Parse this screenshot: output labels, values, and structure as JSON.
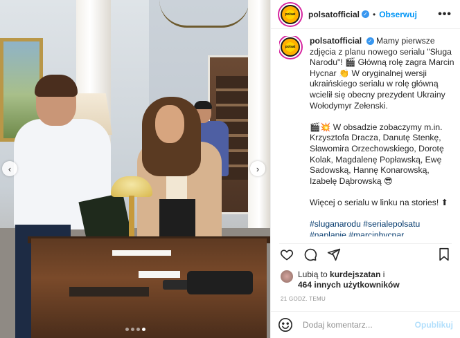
{
  "post": {
    "username": "polsatofficial",
    "verified_mark": "✓",
    "separator": "•",
    "follow_label": "Obserwuj",
    "more_label": "•••",
    "avatar_text": "polsat"
  },
  "caption": {
    "username": "polsatofficial",
    "paragraph1": "Mamy pierwsze zdjęcia z planu nowego serialu \"Sługa Narodu\"! 🎬 Główną rolę zagra Marcin Hycnar 👏 W oryginalnej wersji ukraińskiego serialu w rolę główną wcielił się obecny prezydent Ukrainy Wołodymyr Zełenski.",
    "paragraph2": "🎬💥 W obsadzie zobaczymy m.in. Krzysztofa Dracza, Danutę Stenkę, Sławomira Orzechowskiego, Dorotę Kolak, Magdalenę Popławską, Ewę Sadowską, Hannę Konarowską, Izabelę Dąbrowską 😎",
    "paragraph3": "Więcej o serialu w linku na stories! ⬆",
    "hashtags": "#sluganarodu #serialepolsatu #naplanie #marcinhycnar"
  },
  "icons": {
    "like": "heart-icon",
    "comment": "comment-icon",
    "share": "share-icon",
    "save": "bookmark-icon",
    "emoji": "emoji-icon",
    "prev": "chevron-left-icon",
    "next": "chevron-right-icon"
  },
  "likes": {
    "prefix": "Lubią to ",
    "user": "kurdejszatan",
    "connector": " i",
    "others": "464 innych użytkowników"
  },
  "timestamp": "21 GODZ. TEMU",
  "comment": {
    "placeholder": "Dodaj komentarz...",
    "publish_label": "Opublikuj"
  },
  "carousel": {
    "prev_glyph": "‹",
    "next_glyph": "›",
    "count": 4,
    "active_index": 3
  },
  "colors": {
    "accent": "#0095f6",
    "verified": "#3897f0",
    "publish_disabled": "#b2dffc",
    "hashtag": "#00376b",
    "meta": "#8e8e8e"
  }
}
